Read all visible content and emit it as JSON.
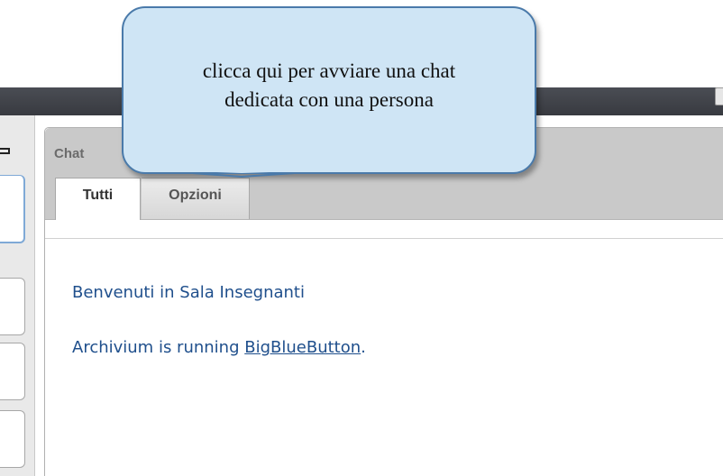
{
  "callout": {
    "line1": "clicca qui per avviare una chat",
    "line2": "dedicata con una persona"
  },
  "chat": {
    "title": "Chat",
    "tabs": [
      {
        "label": "Tutti",
        "selected": true
      },
      {
        "label": "Opzioni",
        "selected": false
      }
    ],
    "messages": {
      "welcome": "Benvenuti in Sala Insegnanti",
      "running_prefix": "Archivium is running ",
      "running_link": "BigBlueButton",
      "running_suffix": "."
    }
  },
  "icons": {
    "window_control": "maximize-icon"
  },
  "colors": {
    "callout_fill": "#cfe5f5",
    "callout_border": "#4a7aaa",
    "message_text": "#1f4f8c",
    "top_bar": "#3f4147",
    "header_gray": "#c9c9c9"
  }
}
